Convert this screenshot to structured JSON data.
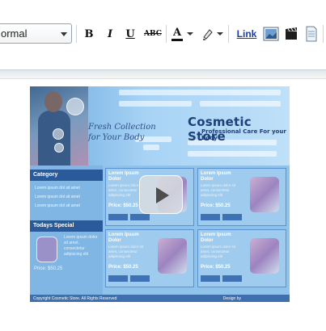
{
  "toolbar": {
    "format_value": "ormal",
    "bold_label": "B",
    "italic_label": "I",
    "underline_label": "U",
    "strike_label": "ABC",
    "font_color_label": "A",
    "link_label": "Link",
    "icons": [
      "image-icon",
      "video-icon",
      "document-icon"
    ]
  },
  "video": {
    "tagline": "Fresh Collection for Your Body",
    "title": "Cosmetic Store",
    "subtitle": "Professional Care For your Body",
    "category_heading": "Category",
    "category_items": [
      "Lorem ipsum dol sit amet",
      "Lorem ipsum dol sit amet",
      "Lorem ipsum dol sit amet"
    ],
    "special_heading": "Todays Special",
    "special_text": "Lorem ipsum dolor sit amet, consectetur adipiscing elit",
    "special_price": "Price: $50.25",
    "products": [
      {
        "label": "Lorem Ipsum Dolor",
        "text": "Lorem ipsum dolor sit amet, consectetur adipiscing elit",
        "price": "Price: $50.25"
      },
      {
        "label": "Lorem Ipsum Dolor",
        "text": "Lorem ipsum dolor sit amet, consectetur adipiscing elit",
        "price": "Price: $50.25"
      },
      {
        "label": "Lorem Ipsum Dolor",
        "text": "Lorem ipsum dolor sit amet, consectetur adipiscing elit",
        "price": "Price: $50.25"
      },
      {
        "label": "Lorem Ipsum Dolor",
        "text": "Lorem ipsum dolor sit amet, consectetur adipiscing elit",
        "price": "Price: $50.25"
      }
    ],
    "footer_left": "Copyright Cosmetic Store. All Rights Reserved",
    "footer_right": "Design by"
  },
  "colors": {
    "link": "#1a3fa3",
    "video_background": "#8fc3ec",
    "video_title": "#1d3f7a"
  }
}
